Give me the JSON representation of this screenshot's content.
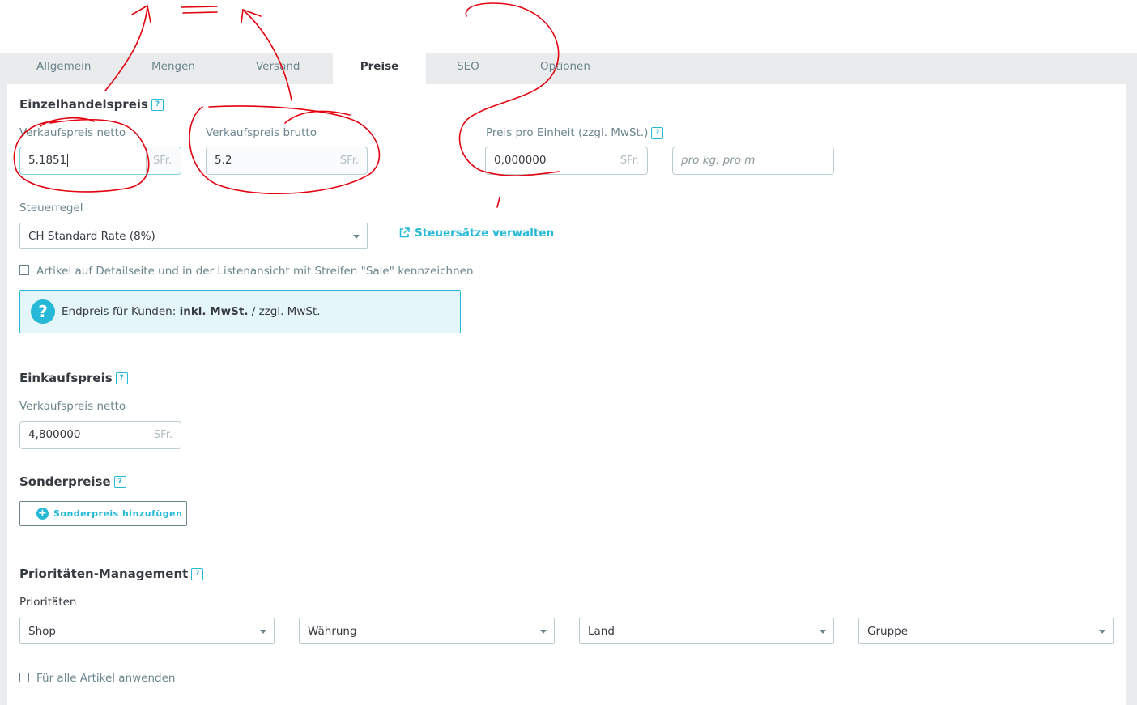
{
  "tabs": [
    {
      "label": "Allgemein"
    },
    {
      "label": "Mengen"
    },
    {
      "label": "Versand"
    },
    {
      "label": "Preise"
    },
    {
      "label": "SEO"
    },
    {
      "label": "Optionen"
    }
  ],
  "retail": {
    "heading": "Einzelhandelspreis",
    "help": "?",
    "net_label": "Verkaufspreis netto",
    "net_value": "5.1851",
    "net_unit": "SFr.",
    "gross_label": "Verkaufspreis brutto",
    "gross_value": "5.2",
    "gross_unit": "SFr.",
    "unit_label": "Preis pro Einheit (zzgl. MwSt.)",
    "unit_value": "0,000000",
    "unit_unit": "SFr.",
    "unit_placeholder": "pro kg, pro m"
  },
  "tax": {
    "label": "Steuerregel",
    "selected": "CH Standard Rate (8%)",
    "manage_link": "Steuersätze verwalten"
  },
  "sale_checkbox": "Artikel auf Detailseite und in der Listenansicht mit Streifen \"Sale\" kennzeichnen",
  "final_price": {
    "prefix": "Endpreis für Kunden: ",
    "incl": "inkl. MwSt.",
    "sep": " / zzgl. MwSt."
  },
  "purchase": {
    "heading": "Einkaufspreis",
    "label": "Verkaufspreis netto",
    "value": "4,800000",
    "unit": "SFr."
  },
  "special": {
    "heading": "Sonderpreise",
    "button": "Sonderpreis hinzufügen"
  },
  "priority": {
    "heading": "Prioritäten-Management",
    "label": "Prioritäten",
    "selects": [
      "Shop",
      "Währung",
      "Land",
      "Gruppe"
    ],
    "apply_all": "Für alle Artikel anwenden"
  },
  "colors": {
    "accent": "#25b9d7",
    "annotation": "#e3000f"
  }
}
